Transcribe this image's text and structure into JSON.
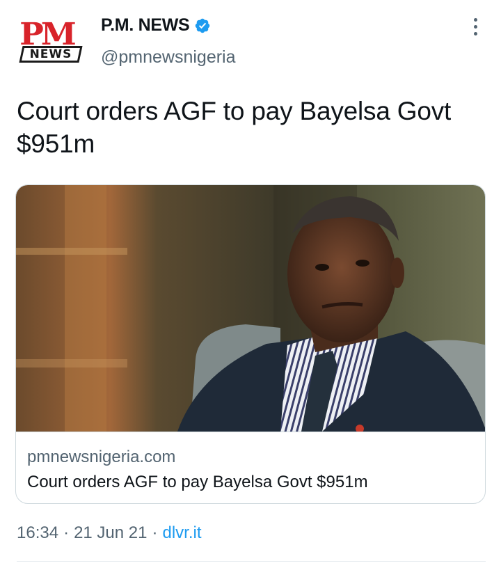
{
  "account": {
    "display_name": "P.M. NEWS",
    "handle": "@pmnewsnigeria",
    "verified": true,
    "avatar_logo_text": [
      "PM",
      "NEWS"
    ]
  },
  "tweet": {
    "text": "Court orders AGF to pay Bayelsa Govt $951m"
  },
  "card": {
    "domain": "pmnewsnigeria.com",
    "title": "Court orders AGF to pay Bayelsa Govt $951m"
  },
  "footer": {
    "time": "16:34",
    "separator": "·",
    "date": "21 Jun 21",
    "source": "dlvr.it"
  },
  "colors": {
    "accent": "#1d9bf0",
    "secondary_text": "#536471",
    "primary_text": "#0f1419",
    "logo_red": "#d8232a",
    "border": "#cfd9de"
  },
  "icons": {
    "verified": "verified-badge-icon",
    "more": "more-options-icon"
  }
}
